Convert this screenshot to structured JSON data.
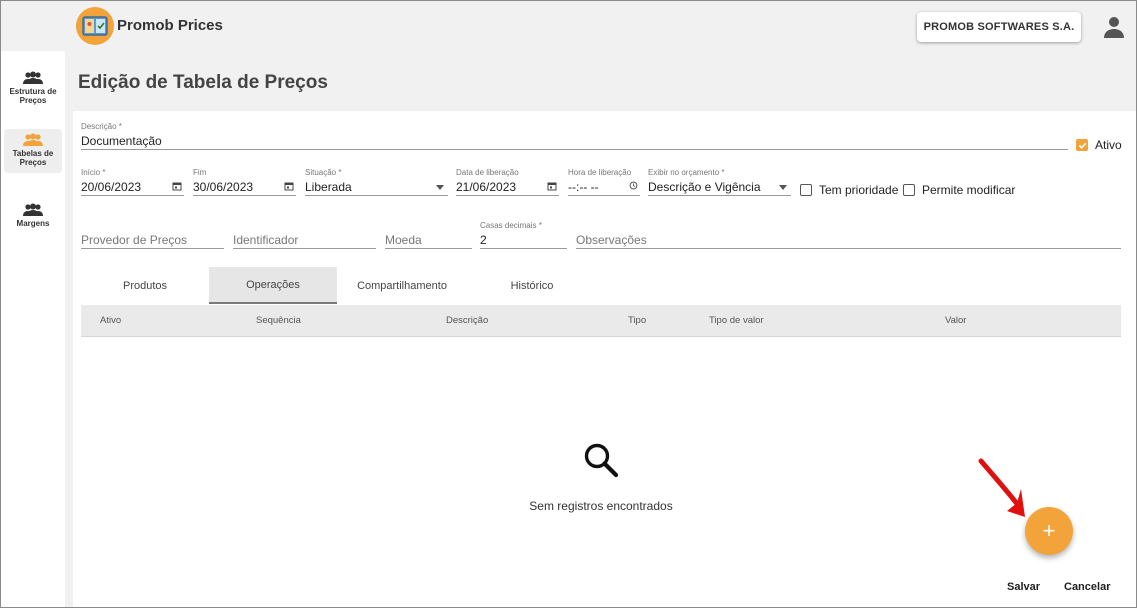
{
  "header": {
    "app_title": "Promob Prices",
    "company": "PROMOB SOFTWARES S.A."
  },
  "sidebar": {
    "items": [
      {
        "label": "Estrutura de Preços",
        "icon": "people-icon",
        "active": false
      },
      {
        "label": "Tabelas de Preços",
        "icon": "people-icon",
        "active": true
      },
      {
        "label": "Margens",
        "icon": "people-icon",
        "active": false
      }
    ]
  },
  "page": {
    "title": "Edição de Tabela de Preços"
  },
  "form": {
    "descricao": {
      "label": "Descrição *",
      "value": "Documentação"
    },
    "ativo": {
      "label": "Ativo",
      "checked": true
    },
    "inicio": {
      "label": "Início *",
      "value": "20/06/2023"
    },
    "fim": {
      "label": "Fim",
      "value": "30/06/2023"
    },
    "situacao": {
      "label": "Situação *",
      "value": "Liberada"
    },
    "data_liberacao": {
      "label": "Data de liberação",
      "value": "21/06/2023"
    },
    "hora_liberacao": {
      "label": "Hora de liberação",
      "value": "--:-- --"
    },
    "exibir_orcamento": {
      "label": "Exibir no orçamento *",
      "value": "Descrição e Vigência"
    },
    "tem_prioridade": {
      "label": "Tem prioridade",
      "checked": false
    },
    "permite_modificar": {
      "label": "Permite modificar",
      "checked": false
    },
    "provedor": {
      "placeholder": "Provedor de Preços"
    },
    "identificador": {
      "placeholder": "Identificador"
    },
    "moeda": {
      "placeholder": "Moeda"
    },
    "casas_decimais": {
      "label": "Casas decimais *",
      "value": "2"
    },
    "observacoes": {
      "placeholder": "Observações"
    }
  },
  "tabs": [
    {
      "label": "Produtos",
      "active": false
    },
    {
      "label": "Operações",
      "active": true
    },
    {
      "label": "Compartilhamento",
      "active": false
    },
    {
      "label": "Histórico",
      "active": false
    }
  ],
  "table": {
    "columns": [
      "Ativo",
      "Sequência",
      "Descrição",
      "Tipo",
      "Tipo de valor",
      "Valor"
    ],
    "empty_text": "Sem registros encontrados"
  },
  "actions": {
    "fab_label": "+",
    "save": "Salvar",
    "cancel": "Cancelar"
  },
  "colors": {
    "accent": "#f2a33a",
    "annotation_arrow": "#e01010"
  }
}
